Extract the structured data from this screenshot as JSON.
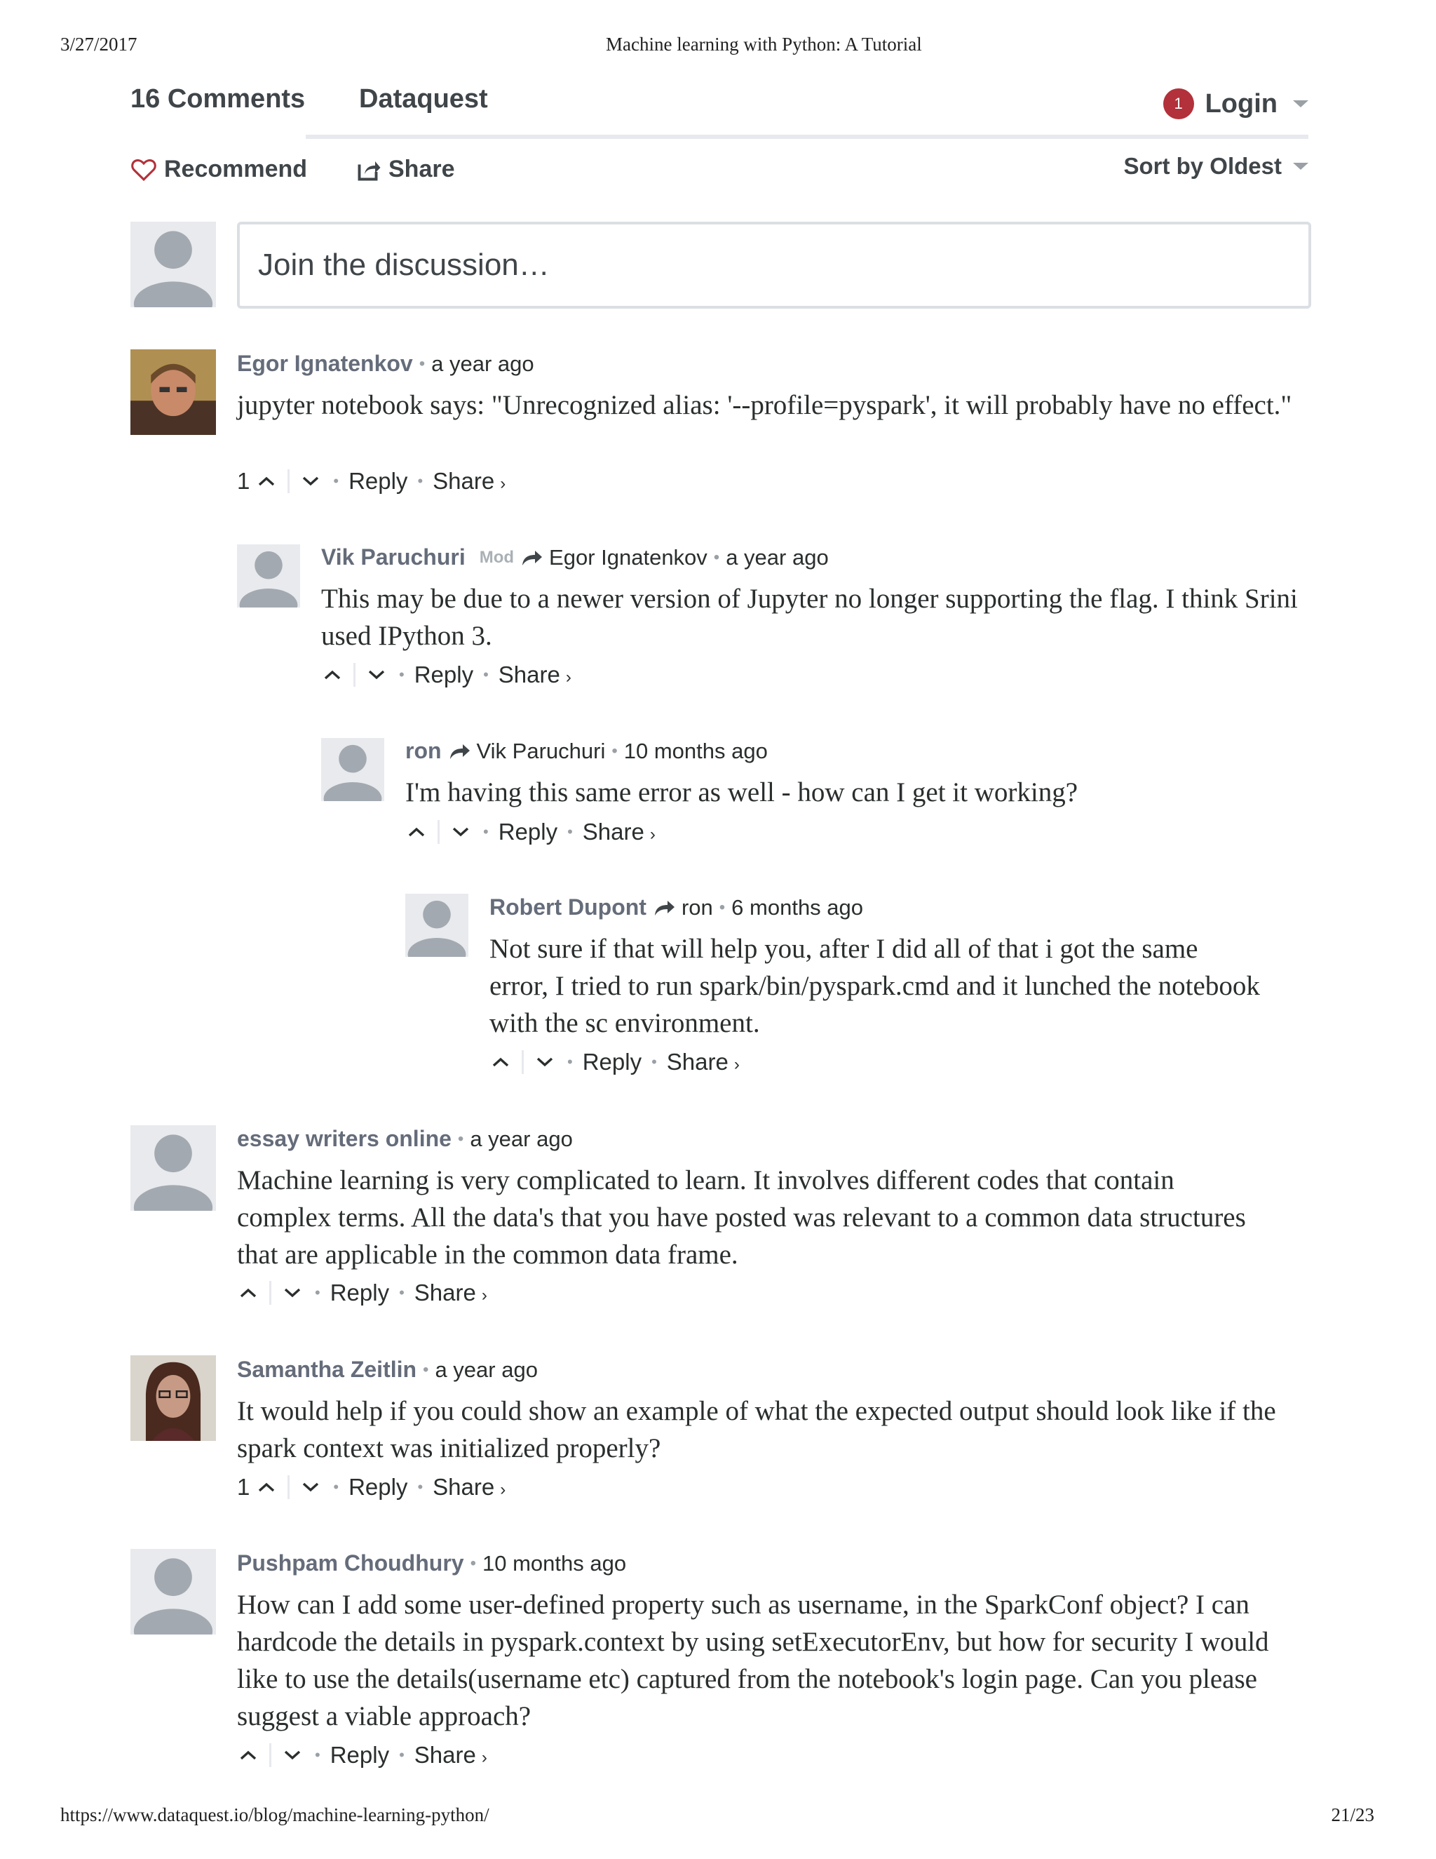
{
  "print_header": {
    "date": "3/27/2017",
    "title": "Machine learning with Python: A Tutorial"
  },
  "print_footer": {
    "url": "https://www.dataquest.io/blog/machine-learning-python/",
    "page": "21/23"
  },
  "topbar": {
    "comment_count": "16 Comments",
    "forum_name": "Dataquest",
    "notification_count": "1",
    "login_label": "Login"
  },
  "actions": {
    "recommend_label": "Recommend",
    "share_label": "Share",
    "sort_label": "Sort by Oldest"
  },
  "composer": {
    "placeholder": "Join the discussion…"
  },
  "comments": [
    {
      "author": "Egor Ignatenkov",
      "time": "a year ago",
      "votes": "1",
      "text": "jupyter notebook says: \"Unrecognized alias: '--profile=pyspark', it will probably have no effect.\"",
      "reply_label": "Reply",
      "share_label": "Share"
    },
    {
      "author": "Vik Paruchuri",
      "badge": "Mod",
      "in_reply_to": "Egor Ignatenkov",
      "time": "a year ago",
      "text": "This may be due to a newer version of Jupyter no longer supporting the flag. I think Srini used IPython 3.",
      "reply_label": "Reply",
      "share_label": "Share"
    },
    {
      "author": "ron",
      "in_reply_to": "Vik Paruchuri",
      "time": "10 months ago",
      "text": "I'm having this same error as well - how can I get it working?",
      "reply_label": "Reply",
      "share_label": "Share"
    },
    {
      "author": "Robert Dupont",
      "in_reply_to": "ron",
      "time": "6 months ago",
      "text": "Not sure if that will help you, after I did all of that i got the same error, I tried to run spark/bin/pyspark.cmd and it lunched the notebook with the sc environment.",
      "reply_label": "Reply",
      "share_label": "Share"
    },
    {
      "author": "essay writers online",
      "time": "a year ago",
      "text": "Machine learning is very complicated to learn. It involves different codes that contain complex terms. All the data's that you have posted was relevant to a common data structures that are applicable in the common data frame.",
      "reply_label": "Reply",
      "share_label": "Share"
    },
    {
      "author": "Samantha Zeitlin",
      "time": "a year ago",
      "votes": "1",
      "text": "It would help if you could show an example of what the expected output should look like if the spark context was initialized properly?",
      "reply_label": "Reply",
      "share_label": "Share"
    },
    {
      "author": "Pushpam Choudhury",
      "time": "10 months ago",
      "text": "How can I add some user-defined property such as username, in the SparkConf object? I can hardcode the details in pyspark.context by using setExecutorEnv, but how for security I would like to use the details(username etc) captured from the notebook's login page. Can you please suggest a viable approach?",
      "reply_label": "Reply",
      "share_label": "Share"
    }
  ]
}
